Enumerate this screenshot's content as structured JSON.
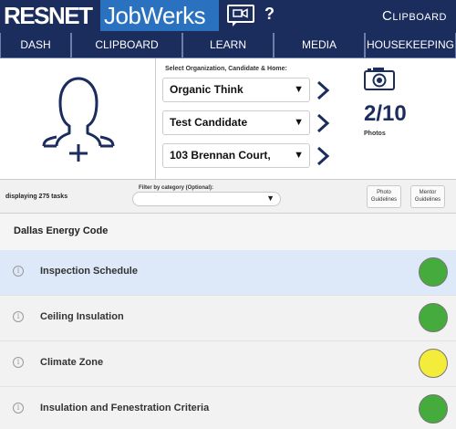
{
  "header": {
    "logo_left": "RESNET",
    "logo_right": "JobWerks",
    "help": "?",
    "page_name": "Clipboard",
    "icons": [
      "video-chat-icon",
      "help-icon"
    ]
  },
  "nav": {
    "items": [
      {
        "label": "DASH"
      },
      {
        "label": "CLIPBOARD"
      },
      {
        "label": "LEARN"
      },
      {
        "label": "MEDIA"
      },
      {
        "label": "HOUSEKEEPING"
      }
    ]
  },
  "selectors": {
    "label": "Select Organization, Candidate & Home:",
    "organization": "Organic Think",
    "candidate": "Test Candidate",
    "home": "103 Brennan Court,"
  },
  "photos": {
    "count": "2/10",
    "label": "Photos",
    "icon": "camera-icon"
  },
  "filter": {
    "task_count": "displaying 275 tasks",
    "label": "Filter by category (Optional):",
    "selected": "",
    "photo_guidelines": [
      "Photo",
      "Guidelines"
    ],
    "mentor_guidelines": [
      "Mentor",
      "Guidelines"
    ]
  },
  "list": {
    "section_title": "Dallas Energy Code",
    "tasks": [
      {
        "label": "Inspection Schedule",
        "status_color": "#44ab3c",
        "selected": true
      },
      {
        "label": "Ceiling Insulation",
        "status_color": "#44ab3c",
        "selected": false
      },
      {
        "label": "Climate Zone",
        "status_color": "#f4ec3a",
        "selected": false
      },
      {
        "label": "Insulation and Fenestration Criteria",
        "status_color": "#44ab3c",
        "selected": false
      }
    ]
  },
  "colors": {
    "navy": "#1b2d5c",
    "brand_blue": "#2a72c0",
    "selected_row": "#dde8f8"
  }
}
